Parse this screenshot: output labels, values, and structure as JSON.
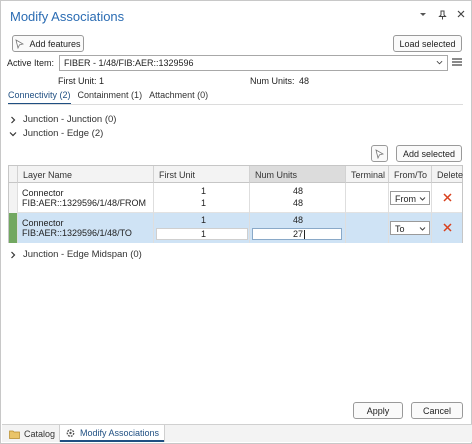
{
  "window": {
    "title": "Modify Associations",
    "icons": [
      "chevron-down-icon",
      "pin-icon",
      "close-icon"
    ]
  },
  "toolbar": {
    "add_features_label": "Add features",
    "load_selected_label": "Load selected"
  },
  "active_item": {
    "label": "Active Item:",
    "value": "FIBER - 1/48/FIB:AER::1329596"
  },
  "units": {
    "first_unit_label": "First Unit:",
    "first_unit_value": "1",
    "num_units_label": "Num Units:",
    "num_units_value": "48"
  },
  "tabs": [
    {
      "label": "Connectivity (2)",
      "active": true
    },
    {
      "label": "Containment (1)",
      "active": false
    },
    {
      "label": "Attachment (0)",
      "active": false
    }
  ],
  "sections": {
    "junction_junction": "Junction - Junction (0)",
    "junction_edge": "Junction - Edge (2)",
    "junction_edge_midspan": "Junction - Edge Midspan (0)"
  },
  "grid": {
    "add_selected_label": "Add selected",
    "columns": [
      "Layer Name",
      "First Unit",
      "Num Units",
      "Terminal",
      "From/To",
      "Delete"
    ],
    "rows": [
      {
        "layer_name": "Connector",
        "layer_id": "FIB:AER::1329596/1/48/FROM",
        "first_unit_top": "1",
        "first_unit_bottom": "1",
        "num_units_top": "48",
        "num_units_bottom": "48",
        "terminal": "",
        "from_to": "From",
        "selected": false
      },
      {
        "layer_name": "Connector",
        "layer_id": "FIB:AER::1329596/1/48/TO",
        "first_unit_top": "1",
        "first_unit_bottom": "1",
        "num_units_top": "48",
        "num_units_bottom": "27",
        "terminal": "",
        "from_to": "To",
        "selected": true
      }
    ]
  },
  "footer": {
    "apply_label": "Apply",
    "cancel_label": "Cancel"
  },
  "statusbar": {
    "tabs": [
      {
        "label": "Catalog",
        "active": false
      },
      {
        "label": "Modify Associations",
        "active": true
      }
    ]
  },
  "colors": {
    "title": "#2b6cb3",
    "accent": "#1f4f82",
    "selected_row": "#cfe3f5",
    "row_marker": "#72a861",
    "delete": "#d9411e"
  }
}
